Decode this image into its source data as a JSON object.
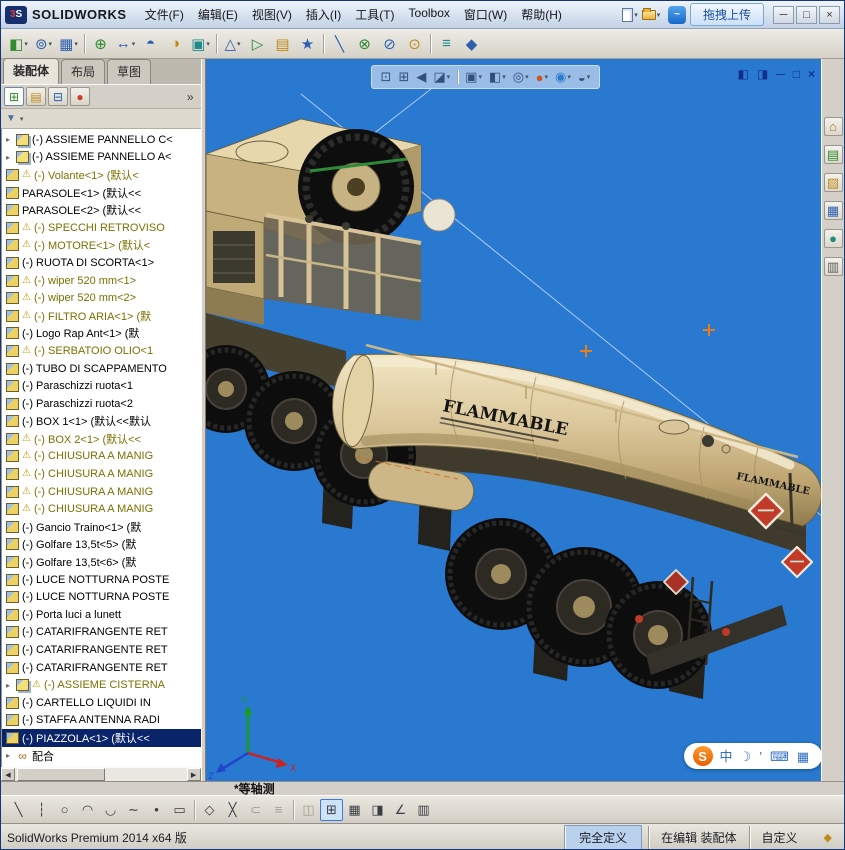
{
  "window": {
    "brand_mark": "3S",
    "brand_name": "SOLIDWORKS",
    "upload_label": "拖拽上传",
    "upload_glyph": "~",
    "quick_icons": [
      {
        "n": "new-document"
      },
      {
        "n": "open-folder"
      }
    ],
    "controls": [
      {
        "n": "minimize-button",
        "g": "─"
      },
      {
        "n": "maximize-button",
        "g": "□"
      },
      {
        "n": "close-button",
        "g": "×"
      }
    ]
  },
  "menubar": {
    "items": [
      {
        "label": "文件(F)"
      },
      {
        "label": "编辑(E)"
      },
      {
        "label": "视图(V)"
      },
      {
        "label": "插入(I)"
      },
      {
        "label": "工具(T)"
      },
      {
        "label": "Toolbox"
      },
      {
        "label": "窗口(W)"
      },
      {
        "label": "帮助(H)"
      }
    ]
  },
  "toolbar": {
    "items": [
      {
        "n": "insert-components",
        "g": "◧",
        "c": "g",
        "dd": 1
      },
      {
        "n": "mate",
        "g": "⊚",
        "c": "b",
        "dd": 1
      },
      {
        "n": "linear-component-pattern",
        "g": "▦",
        "c": "b",
        "dd": 1
      },
      {
        "n": "smart-fasteners",
        "g": "⊕",
        "c": "g",
        "sep": 1
      },
      {
        "n": "move-component",
        "g": "↔",
        "c": "b",
        "dd": 1
      },
      {
        "n": "rotate-component",
        "g": "◓",
        "c": "b"
      },
      {
        "n": "show-hidden-components",
        "g": "◑",
        "c": "y"
      },
      {
        "n": "assembly-features",
        "g": "▣",
        "c": "t",
        "dd": 1
      },
      {
        "n": "reference-geometry",
        "g": "△",
        "c": "b",
        "dd": 1,
        "sep": 1
      },
      {
        "n": "new-motion-study",
        "g": "▷",
        "c": "g"
      },
      {
        "n": "bill-of-materials",
        "g": "▤",
        "c": "y"
      },
      {
        "n": "exploded-view",
        "g": "★",
        "c": "b"
      },
      {
        "n": "explode-line-sketch",
        "g": "╲",
        "c": "b",
        "sep": 1
      },
      {
        "n": "interference-detection",
        "g": "⊗",
        "c": "g"
      },
      {
        "n": "clearance-verification",
        "g": "⊘",
        "c": "b"
      },
      {
        "n": "hole-alignment",
        "g": "⊙",
        "c": "y"
      },
      {
        "n": "measure",
        "g": "≡",
        "c": "t",
        "sep": 1
      },
      {
        "n": "mass-properties",
        "g": "◆",
        "c": "b"
      }
    ]
  },
  "tabs": {
    "items": [
      {
        "label": "装配体",
        "cls": "active"
      },
      {
        "label": "布局"
      },
      {
        "label": "草图"
      }
    ]
  },
  "panel": {
    "chevron": "»",
    "filter_glyph": "▼",
    "manager_tabs": [
      {
        "n": "featuremanager-tab",
        "g": "⊞",
        "c": "#2f8b2f",
        "cls": "active"
      },
      {
        "n": "propertymanager-tab",
        "g": "▤",
        "c": "#c08a1a"
      },
      {
        "n": "configurationmanager-tab",
        "g": "⊟",
        "c": "#2d5fb0"
      },
      {
        "n": "displaymanager-tab",
        "g": "●",
        "c": "#cc4422"
      }
    ]
  },
  "tree": {
    "items": [
      {
        "t": "(-) ASSIEME PANNELLO C<",
        "k": "asm",
        "s": "n",
        "w": 0,
        "a": 1
      },
      {
        "t": "(-) ASSIEME PANNELLO A<",
        "k": "asm",
        "s": "n",
        "w": 0,
        "a": 1
      },
      {
        "t": "(-) Volante<1> (默认<",
        "k": "part",
        "s": "o",
        "w": 1
      },
      {
        "t": "PARASOLE<1> (默认<<",
        "k": "part",
        "s": "n",
        "w": 0
      },
      {
        "t": "PARASOLE<2> (默认<<",
        "k": "part",
        "s": "n",
        "w": 0
      },
      {
        "t": "(-) SPECCHI RETROVISO",
        "k": "part",
        "s": "o",
        "w": 1
      },
      {
        "t": "(-) MOTORE<1> (默认<",
        "k": "part",
        "s": "o",
        "w": 1
      },
      {
        "t": "(-) RUOTA DI SCORTA<1>",
        "k": "part",
        "s": "n",
        "w": 0
      },
      {
        "t": "(-) wiper 520 mm<1>",
        "k": "part",
        "s": "o",
        "w": 1
      },
      {
        "t": "(-) wiper 520 mm<2>",
        "k": "part",
        "s": "o",
        "w": 1
      },
      {
        "t": "(-) FILTRO ARIA<1> (默",
        "k": "part",
        "s": "o",
        "w": 1
      },
      {
        "t": "(-) Logo Rap Ant<1> (默",
        "k": "part",
        "s": "n",
        "w": 0
      },
      {
        "t": "(-) SERBATOIO OLIO<1",
        "k": "part",
        "s": "o",
        "w": 1
      },
      {
        "t": "(-) TUBO DI SCAPPAMENTO",
        "k": "part",
        "s": "n",
        "w": 0
      },
      {
        "t": "(-) Paraschizzi ruota<1",
        "k": "part",
        "s": "n",
        "w": 0
      },
      {
        "t": "(-) Paraschizzi ruota<2",
        "k": "part",
        "s": "n",
        "w": 0
      },
      {
        "t": "(-) BOX 1<1> (默认<<默认",
        "k": "part",
        "s": "n",
        "w": 0
      },
      {
        "t": "(-) BOX 2<1> (默认<<",
        "k": "part",
        "s": "o",
        "w": 1
      },
      {
        "t": "(-) CHIUSURA A MANIG",
        "k": "part",
        "s": "o",
        "w": 1
      },
      {
        "t": "(-) CHIUSURA A MANIG",
        "k": "part",
        "s": "o",
        "w": 1
      },
      {
        "t": "(-) CHIUSURA A MANIG",
        "k": "part",
        "s": "o",
        "w": 1
      },
      {
        "t": "(-) CHIUSURA A MANIG",
        "k": "part",
        "s": "o",
        "w": 1
      },
      {
        "t": "(-) Gancio Traino<1> (默",
        "k": "part",
        "s": "n",
        "w": 0
      },
      {
        "t": "(-) Golfare 13,5t<5> (默",
        "k": "part",
        "s": "n",
        "w": 0
      },
      {
        "t": "(-) Golfare 13,5t<6> (默",
        "k": "part",
        "s": "n",
        "w": 0
      },
      {
        "t": "(-) LUCE NOTTURNA POSTE",
        "k": "part",
        "s": "n",
        "w": 0
      },
      {
        "t": "(-) LUCE NOTTURNA POSTE",
        "k": "part",
        "s": "n",
        "w": 0
      },
      {
        "t": "(-) Porta luci a lunett",
        "k": "part",
        "s": "n",
        "w": 0
      },
      {
        "t": "(-) CATARIFRANGENTE RET",
        "k": "part",
        "s": "n",
        "w": 0
      },
      {
        "t": "(-) CATARIFRANGENTE RET",
        "k": "part",
        "s": "n",
        "w": 0
      },
      {
        "t": "(-) CATARIFRANGENTE RET",
        "k": "part",
        "s": "n",
        "w": 0
      },
      {
        "t": "(-) ASSIEME CISTERNA",
        "k": "asm",
        "s": "o",
        "w": 1,
        "a": 1
      },
      {
        "t": "(-) CARTELLO LIQUIDI IN",
        "k": "part",
        "s": "n",
        "w": 0
      },
      {
        "t": "(-) STAFFA ANTENNA RADI",
        "k": "part",
        "s": "n",
        "w": 0
      },
      {
        "t": "(-) PIAZZOLA<1> (默认<<",
        "k": "part",
        "s": "sel",
        "w": 0
      },
      {
        "t": "配合",
        "k": "mates",
        "s": "n",
        "w": 0,
        "a": 1
      }
    ]
  },
  "viewport": {
    "view_label": "*等轴测",
    "headsup": [
      {
        "n": "zoom-to-fit",
        "g": "⊡"
      },
      {
        "n": "zoom-to-area",
        "g": "⊞"
      },
      {
        "n": "previous-view",
        "g": "◀"
      },
      {
        "n": "section-view",
        "g": "◪",
        "dd": 1
      },
      {
        "n": "view-orientation",
        "g": "▣",
        "dd": 1,
        "sep": 1
      },
      {
        "n": "display-style",
        "g": "◧",
        "dd": 1
      },
      {
        "n": "hide-show-items",
        "g": "◎",
        "dd": 1
      },
      {
        "n": "edit-appearance",
        "g": "●",
        "dd": 1,
        "c": "ap"
      },
      {
        "n": "apply-scene",
        "g": "◉",
        "dd": 1,
        "c": "sc"
      },
      {
        "n": "view-settings",
        "g": "◒",
        "dd": 1
      }
    ],
    "pane_controls": [
      {
        "n": "viewport-split-left",
        "g": "◧"
      },
      {
        "n": "viewport-split-top",
        "g": "◨"
      },
      {
        "n": "viewport-minimize",
        "g": "─"
      },
      {
        "n": "viewport-restore",
        "g": "□"
      },
      {
        "n": "viewport-close",
        "g": "×"
      }
    ],
    "taskpane": [
      {
        "n": "solidworks-resources",
        "g": "⌂",
        "c": "#a8741a"
      },
      {
        "n": "design-library",
        "g": "▤",
        "c": "#2f8b2f"
      },
      {
        "n": "file-explorer",
        "g": "▨",
        "c": "#c08a1a"
      },
      {
        "n": "view-palette",
        "g": "▦",
        "c": "#2d5fb0"
      },
      {
        "n": "appearances-scenes",
        "g": "●",
        "c": "#1f8e7e"
      },
      {
        "n": "custom-properties",
        "g": "▥",
        "c": "#5c5c5c"
      }
    ],
    "truck": {
      "tank_label": "FLAMMABLE",
      "rear_label": "FLAMMABLE"
    },
    "triad": {
      "x": "X",
      "y": "Y",
      "z": "Z"
    }
  },
  "ime": {
    "logo": "S",
    "mode": "中",
    "icons": [
      {
        "n": "skin-moon",
        "g": "☽"
      },
      {
        "n": "symbol-entry",
        "g": "’"
      },
      {
        "n": "soft-keyboard",
        "g": "⌨"
      },
      {
        "n": "ime-toolbox",
        "g": "▦"
      }
    ]
  },
  "sketchbar": {
    "items": [
      {
        "n": "sketch-line",
        "g": "╲"
      },
      {
        "n": "sketch-centerline",
        "g": "┆"
      },
      {
        "n": "sketch-circle",
        "g": "○"
      },
      {
        "n": "sketch-arc",
        "g": "◠"
      },
      {
        "n": "sketch-tangent-arc",
        "g": "◡"
      },
      {
        "n": "sketch-spline",
        "g": "∼"
      },
      {
        "n": "sketch-point",
        "g": "•"
      },
      {
        "n": "sketch-rectangle",
        "g": "▭"
      },
      {
        "n": "sketch-polygon",
        "g": "◇",
        "sep": 1
      },
      {
        "n": "trim-entities",
        "g": "╳"
      },
      {
        "n": "convert-entities",
        "g": "⊂",
        "cls": "disabled"
      },
      {
        "n": "offset-entities",
        "g": "≡",
        "cls": "disabled"
      },
      {
        "n": "mirror-entities",
        "g": "◫",
        "cls": "disabled",
        "sep": 1
      },
      {
        "n": "grid-system",
        "g": "⊞",
        "cls": "active"
      },
      {
        "n": "snap-options",
        "g": "▦"
      },
      {
        "n": "units-settings",
        "g": "◨"
      },
      {
        "n": "angle-snap",
        "g": "∠"
      },
      {
        "n": "sketch-settings",
        "g": "▥"
      }
    ]
  },
  "statusbar": {
    "left": "SolidWorks Premium 2014 x64 版",
    "define_state": "完全定义",
    "edit_state": "在编辑 装配体",
    "custom": "自定义",
    "icon": "◆"
  }
}
